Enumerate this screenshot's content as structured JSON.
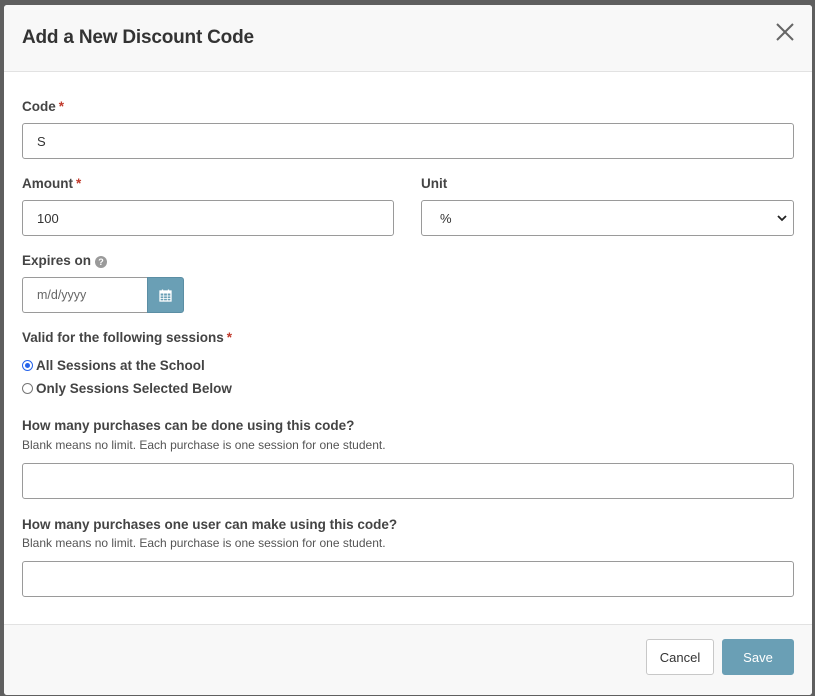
{
  "modal": {
    "title": "Add a New Discount Code"
  },
  "form": {
    "code": {
      "label": "Code",
      "required_mark": "*",
      "value": "S"
    },
    "amount": {
      "label": "Amount",
      "required_mark": "*",
      "value": "100"
    },
    "unit": {
      "label": "Unit",
      "selected": "%"
    },
    "expires": {
      "label": "Expires on",
      "help_icon": "question-circle-icon",
      "placeholder": "m/d/yyyy",
      "calendar_icon": "calendar-icon"
    },
    "sessions": {
      "label": "Valid for the following sessions",
      "required_mark": "*",
      "options": [
        {
          "label": "All Sessions at the School",
          "checked": true
        },
        {
          "label": "Only Sessions Selected Below",
          "checked": false
        }
      ]
    },
    "max_purchases": {
      "label": "How many purchases can be done using this code?",
      "help": "Blank means no limit. Each purchase is one session for one student.",
      "value": ""
    },
    "max_per_user": {
      "label": "How many purchases one user can make using this code?",
      "help": "Blank means no limit. Each purchase is one session for one student.",
      "value": ""
    }
  },
  "footer": {
    "cancel_label": "Cancel",
    "save_label": "Save"
  },
  "colors": {
    "primary": "#6a9fb5",
    "required": "#c0392b",
    "radio_checked": "#2563eb"
  }
}
